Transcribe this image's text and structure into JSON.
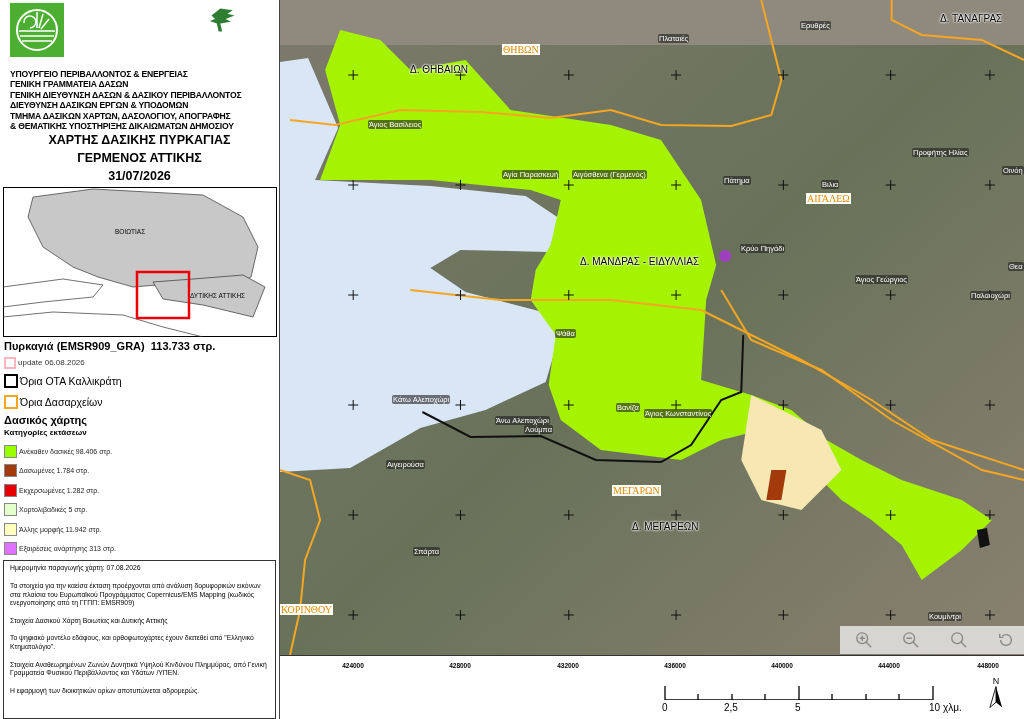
{
  "header": {
    "lines": [
      "ΥΠΟΥΡΓΕΙΟ ΠΕΡΙΒΑΛΛΟΝΤΟΣ & ΕΝΕΡΓΕΙΑΣ",
      "ΓΕΝΙΚΗ ΓΡΑΜΜΑΤΕΙΑ ΔΑΣΩΝ",
      "ΓΕΝΙΚΗ ΔΙΕΥΘΥΝΣΗ ΔΑΣΩΝ & ΔΑΣΙΚΟΥ ΠΕΡΙΒΑΛΛΟΝΤΟΣ",
      "ΔΙΕΥΘΥΝΣΗ ΔΑΣΙΚΩΝ ΕΡΓΩΝ & ΥΠΟΔΟΜΩΝ",
      "ΤΜΗΜΑ ΔΑΣΙΚΩΝ ΧΑΡΤΩΝ, ΔΑΣΟΛΟΓΙΟΥ, ΑΠΟΓΡΑΦΗΣ",
      "& ΘΕΜΑΤΙΚΗΣ ΥΠΟΣΤΗΡΙΞΗΣ ΔΙΚΑΙΩΜΑΤΩΝ ΔΗΜΟΣΙΟΥ"
    ],
    "title": [
      "ΧΑΡΤΗΣ ΔΑΣΙΚΗΣ ΠΥΡΚΑΓΙΑΣ",
      "ΓΕΡΜΕΝΟΣ ΑΤΤΙΚΗΣ",
      "31/07/2026"
    ]
  },
  "inset_map": {
    "labels": [
      "ΒΟΙΩΤΙΑΣ",
      "ΔΥΤΙΚΗΣ ΑΤΤΙΚΗΣ"
    ]
  },
  "legend": {
    "fire_title": "Πυρκαγιά (EMSR909_GRA)  113.733 στρ.",
    "layers": [
      {
        "label": "update 06.08.2026",
        "color": "#ffb6c1",
        "kind": "outline"
      },
      {
        "label": "Όρια ΟΤΑ Καλλικράτη",
        "color": "#000000",
        "kind": "outline"
      },
      {
        "label": "Όρια Δασαρχείων",
        "color": "#f5a623",
        "kind": "outline"
      }
    ],
    "forest_title": "Δασικός χάρτης",
    "categories_title": "Κατηγορίες εκτάσεων",
    "categories": [
      {
        "label": "Ανέκαθεν δασικές 98.406 στρ.",
        "color": "#99ff00"
      },
      {
        "label": "Δασωμένες 1.784 στρ.",
        "color": "#a33a0c"
      },
      {
        "label": "Εκχερσωμένες 1.282 στρ.",
        "color": "#e60000"
      },
      {
        "label": "Χορτολιβαδικές 5 στρ.",
        "color": "#e3ffcc"
      },
      {
        "label": "Άλλης μορφής 11.942 στρ.",
        "color": "#ffffc0"
      },
      {
        "label": "Εξαιρέσεις ανάρτησης 313 στρ.",
        "color": "#df73ff"
      }
    ]
  },
  "notes": [
    "Ημερομηνία παραγωγής χάρτη: 07.08.2026",
    "Τα στοιχεία για την καείσα έκταση προέρχονται από ανάλυση δορυφορικών εικόνων στα πλαίσια του Ευρωπαϊκού Προγράμματος Copernicus/EMS Mapping (κωδικός ενεργοποίησης από τη ΓΓΠΠ: EMSR909)",
    "Στοιχεία Δασικού Χάρτη Βοιωτίας και Δυτικής Αττικής",
    "Το ψηφιακό μοντέλο εδάφους, και ορθοφωτοχάρτες έχουν διατεθεί από \"Ελληνικό Κτηματολόγιο\".",
    "Στοιχεία Αναθεωρημένων Ζωνών Δυνητικά Υψηλού Κινδύνου Πλημμύρας, από Γενική Γραμματεία Φυσικού Περιβάλλοντος και Υδάτων /ΥΠΕΝ.",
    "Η εφαρμογή των διοικητικών ορίων αποτυπώνεται αδρομερώς."
  ],
  "map": {
    "labels": [
      {
        "text": "ΘΗΒΩΝ",
        "kind": "office"
      },
      {
        "text": "Δ. ΘΗΒΑΙΩΝ",
        "kind": "municipality"
      },
      {
        "text": "Πλαταιές",
        "kind": "place"
      },
      {
        "text": "Ερυθρές",
        "kind": "place"
      },
      {
        "text": "Δ. ΤΑΝΑΓΡΑΣ",
        "kind": "municipality"
      },
      {
        "text": "Άγιος Βασίλειος",
        "kind": "place"
      },
      {
        "text": "Αγία Παρασκευή",
        "kind": "place"
      },
      {
        "text": "Αιγόσθενα (Γερμενός)",
        "kind": "place"
      },
      {
        "text": "Πάτημα",
        "kind": "place"
      },
      {
        "text": "Βιλια",
        "kind": "place"
      },
      {
        "text": "ΑΙΓΑΛΕΩ",
        "kind": "office"
      },
      {
        "text": "Προφήτης Ηλίας",
        "kind": "place"
      },
      {
        "text": "Οινόη",
        "kind": "place"
      },
      {
        "text": "Κρύο Πηγάδι",
        "kind": "place"
      },
      {
        "text": "Δ. ΜΑΝΔΡΑΣ - ΕΙΔΥΛΛΙΑΣ",
        "kind": "municipality"
      },
      {
        "text": "Άγιος Γεώργιος",
        "kind": "place"
      },
      {
        "text": "Θεα",
        "kind": "place"
      },
      {
        "text": "Παλαιοχώρι",
        "kind": "place"
      },
      {
        "text": "Ψάθα",
        "kind": "place"
      },
      {
        "text": "Κάτω Αλεποχώρι",
        "kind": "place"
      },
      {
        "text": "Άνω Αλεποχώρι",
        "kind": "place"
      },
      {
        "text": "Λούμπα",
        "kind": "place"
      },
      {
        "text": "Βανίζα",
        "kind": "place"
      },
      {
        "text": "Άγιος Κωνσταντίνος",
        "kind": "place"
      },
      {
        "text": "Αιγειρούσα",
        "kind": "place"
      },
      {
        "text": "ΜΕΓΑΡΩΝ",
        "kind": "office"
      },
      {
        "text": "Δ. ΜΕΓΑΡΕΩΝ",
        "kind": "municipality"
      },
      {
        "text": "Σπάρτα",
        "kind": "place"
      },
      {
        "text": "ΚΟΡΙΝΘΟΥ",
        "kind": "office"
      },
      {
        "text": "Κουμίντρι",
        "kind": "place"
      }
    ],
    "x_ticks": [
      "424000",
      "428000",
      "432000",
      "436000",
      "440000",
      "444000",
      "448000"
    ],
    "scale": {
      "labels": [
        "0",
        "2,5",
        "5",
        "10 χλμ."
      ]
    },
    "north": "N"
  }
}
